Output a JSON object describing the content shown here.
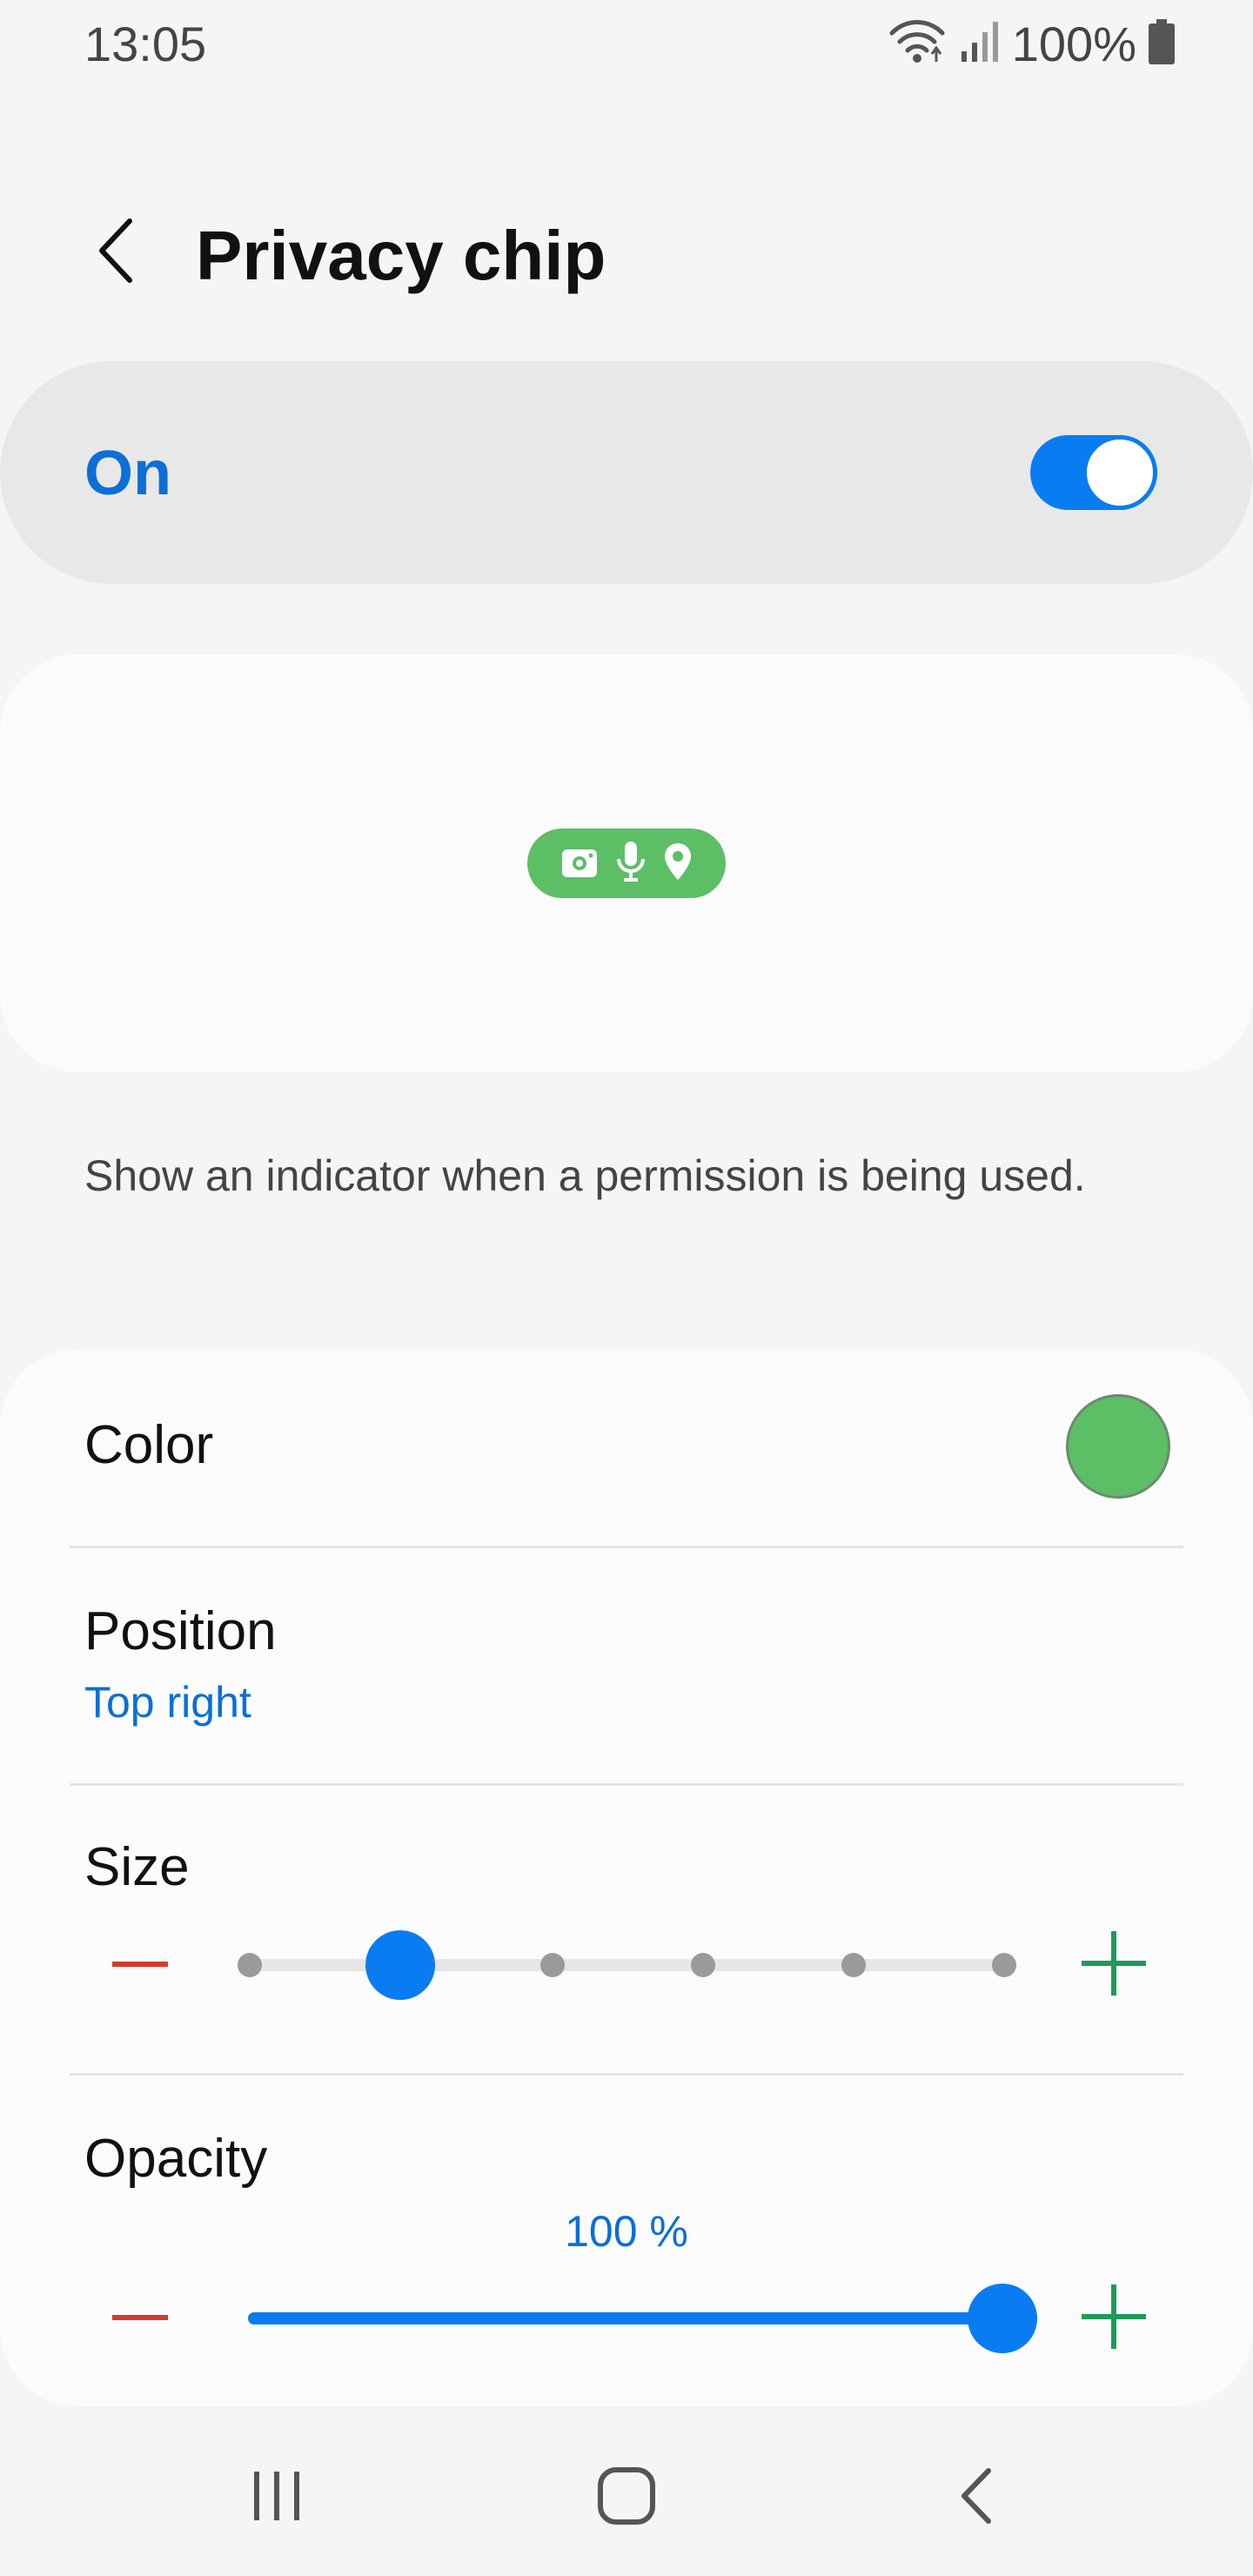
{
  "status_bar": {
    "time": "13:05",
    "battery_text": "100%",
    "icons": [
      "wifi-icon",
      "signal-icon",
      "battery-icon"
    ]
  },
  "header": {
    "title": "Privacy chip",
    "back_icon": "chevron-left-icon"
  },
  "master_switch": {
    "label": "On",
    "checked": true
  },
  "preview": {
    "chip_icons": [
      "camera-icon",
      "microphone-icon",
      "location-icon"
    ],
    "chip_color": "#5cbf66"
  },
  "description": "Show an indicator when a permission is being used.",
  "settings": {
    "color": {
      "label": "Color",
      "value": "#5cbf66"
    },
    "position": {
      "label": "Position",
      "value": "Top right"
    },
    "size": {
      "label": "Size",
      "steps": 6,
      "selected_step": 2
    },
    "opacity": {
      "label": "Opacity",
      "value_text": "100 %",
      "value": 100
    }
  },
  "nav_bar": {
    "buttons": [
      "recents-icon",
      "home-icon",
      "back-icon"
    ]
  },
  "colors": {
    "accent": "#0a7cf2",
    "accent_text": "#0a6fd6",
    "chip_green": "#5cbf66",
    "minus_red": "#d63a2e",
    "plus_green": "#1f9a5a"
  }
}
